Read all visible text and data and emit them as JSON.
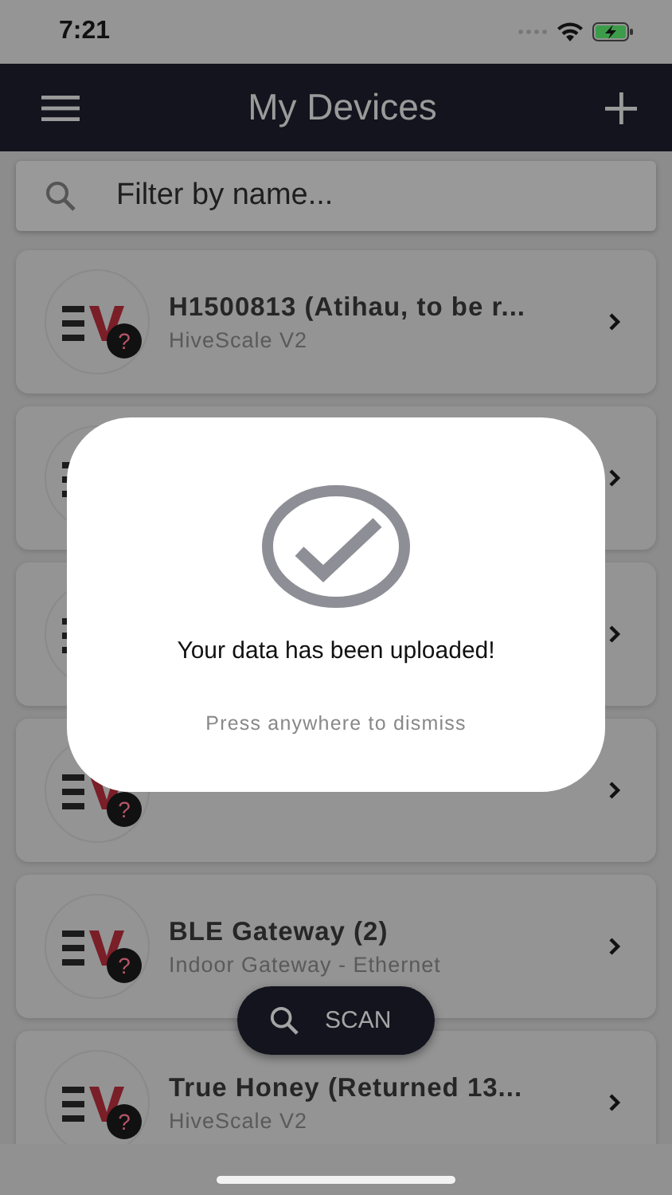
{
  "status_bar": {
    "time": "7:21"
  },
  "header": {
    "title": "My Devices"
  },
  "search": {
    "placeholder": "Filter by name..."
  },
  "devices": [
    {
      "kind": "device",
      "title": "H1500813 (Atihau, to be r...",
      "subtitle": "HiveScale V2",
      "badge": "?"
    },
    {
      "kind": "device"
    },
    {
      "kind": "device"
    },
    {
      "kind": "device",
      "badge": "?"
    },
    {
      "kind": "device",
      "title": "BLE Gateway (2)",
      "subtitle": "Indoor Gateway - Ethernet",
      "badge": "?"
    },
    {
      "kind": "device",
      "title": "True Honey (Returned 13...",
      "subtitle": "HiveScale V2",
      "badge": "?"
    }
  ],
  "scan_button": {
    "label": "SCAN"
  },
  "dialog": {
    "message": "Your data has been uploaded!",
    "hint": "Press anywhere to dismiss"
  }
}
